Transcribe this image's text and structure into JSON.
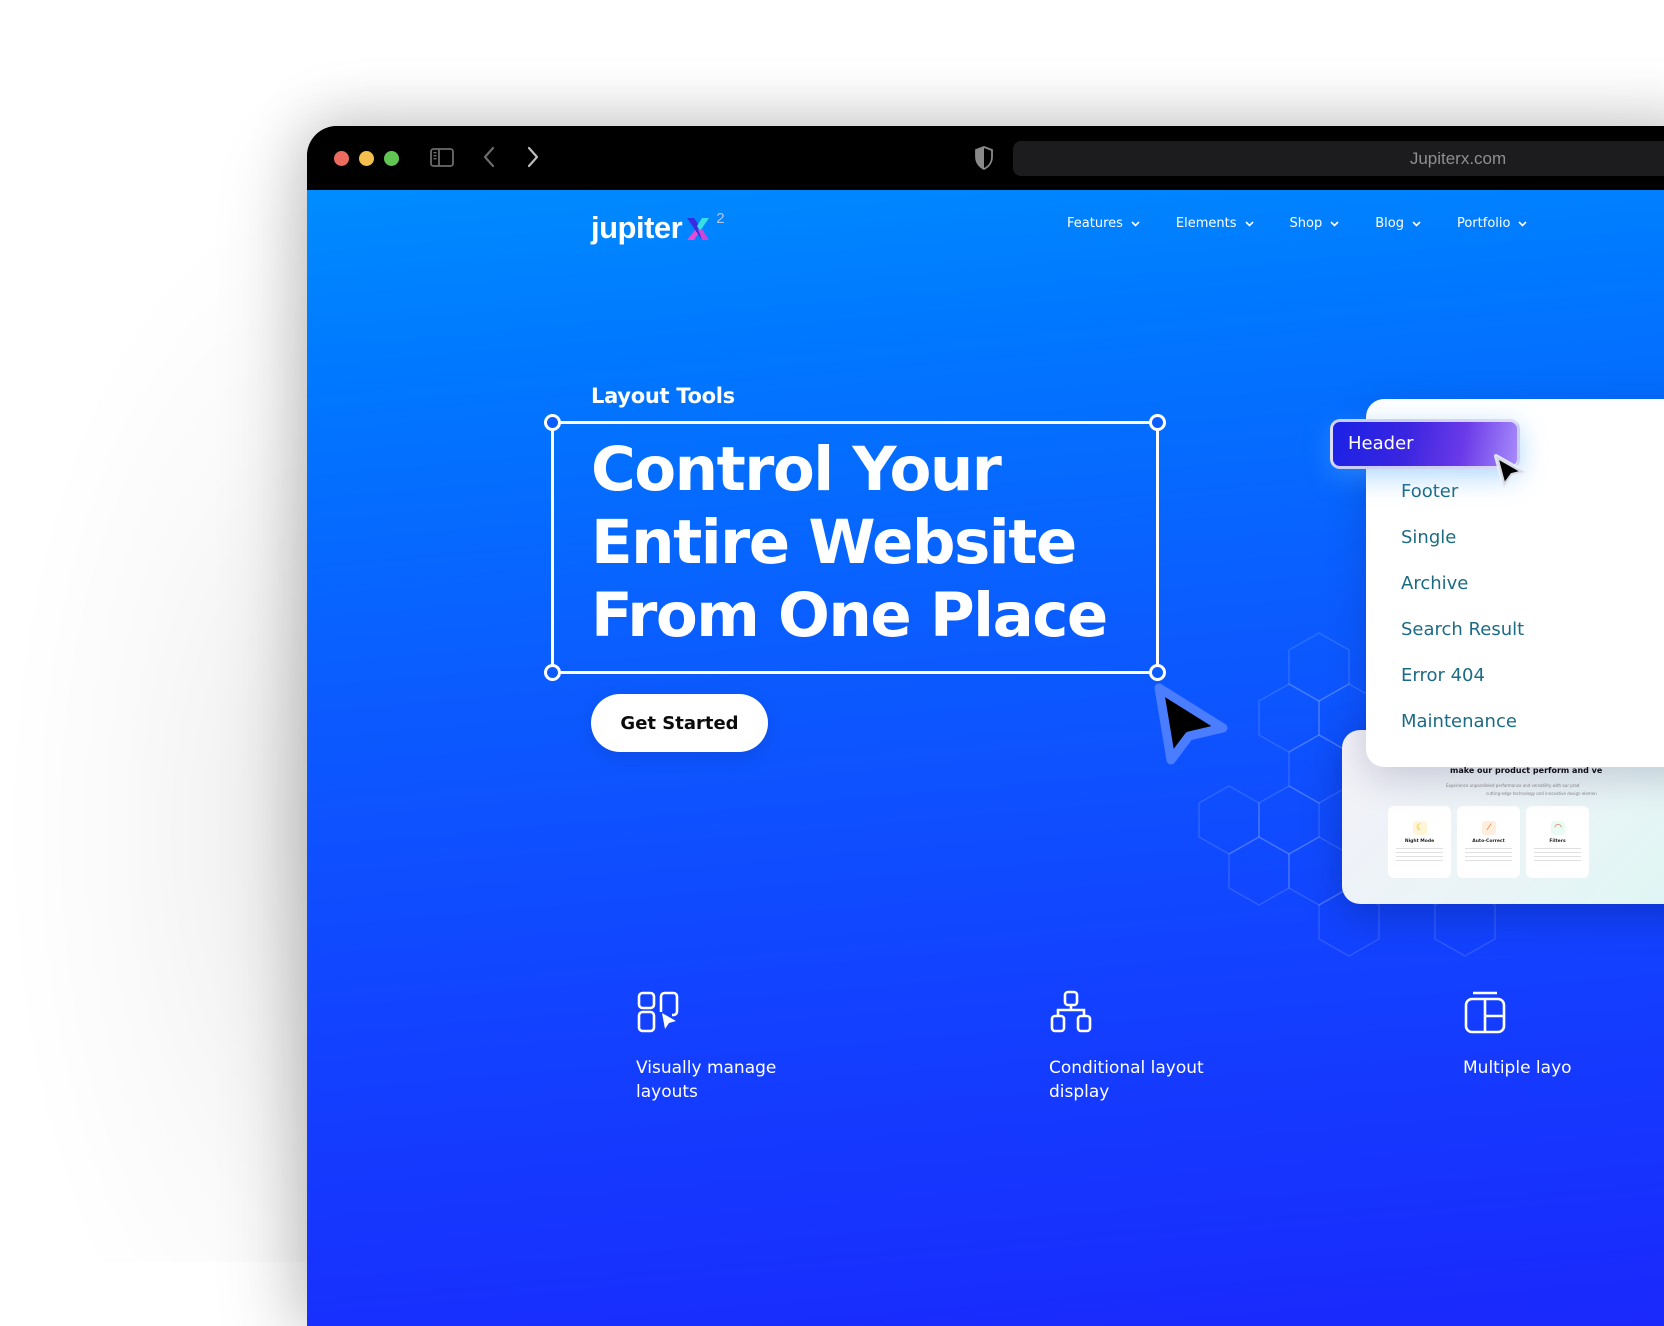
{
  "browser": {
    "address": "Jupiterx.com",
    "traffic_lights": {
      "close": "#ed6a5e",
      "minimize": "#f4bf4f",
      "maximize": "#61c554"
    },
    "icons": [
      "sidebar-icon",
      "back-icon",
      "forward-icon",
      "shield-icon"
    ]
  },
  "site": {
    "logo": {
      "text": "jupiter",
      "mark": "X",
      "superscript": "2"
    },
    "nav": [
      {
        "label": "Features"
      },
      {
        "label": "Elements"
      },
      {
        "label": "Shop"
      },
      {
        "label": "Blog"
      },
      {
        "label": "Portfolio"
      }
    ],
    "hero": {
      "eyebrow": "Layout Tools",
      "headline_lines": [
        "Control Your",
        "Entire Website",
        "From One Place"
      ],
      "cta_label": "Get Started"
    },
    "layout_menu": {
      "active": "Header",
      "items": [
        "Footer",
        "Single",
        "Archive",
        "Search Result",
        "Error 404",
        "Maintenance"
      ]
    },
    "preview": {
      "title": "make our product perform and ve",
      "subtitle_line1": "Experience unparalleled performance and versatility with our prod",
      "subtitle_line2": "cutting-edge technology and innovative design elemen",
      "cards": [
        {
          "title": "Night Mode",
          "icon": "moon-icon",
          "glyph": "☾"
        },
        {
          "title": "Auto-Correct",
          "icon": "wand-icon",
          "glyph": "⁄"
        },
        {
          "title": "Filters",
          "icon": "rainbow-icon",
          "glyph": "◠"
        }
      ]
    },
    "features": [
      {
        "label": "Visually manage layouts",
        "icon": "layout-cursor-icon"
      },
      {
        "label": "Conditional layout display",
        "icon": "hierarchy-icon"
      },
      {
        "label": "Multiple layo",
        "icon": "layout-panels-icon"
      }
    ],
    "colors": {
      "hero_top": "#008cff",
      "hero_bottom": "#1a28fc",
      "menu_text": "#1c6b84",
      "active_gradient_start": "#1a22e6",
      "active_gradient_end": "#a78bfa"
    }
  }
}
